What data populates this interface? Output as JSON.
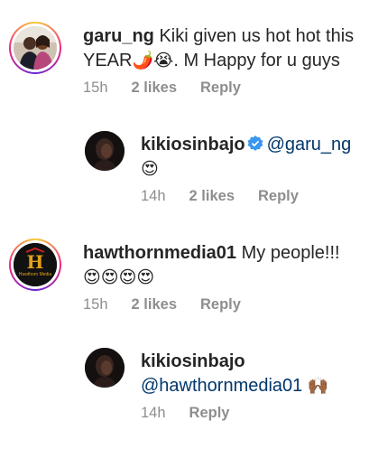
{
  "comments": [
    {
      "username": "garu_ng",
      "text": "Kiki given us hot hot this YEAR",
      "emoji_after_text": "🌶️😭",
      "text_tail": ". M  Happy for u guys",
      "time": "15h",
      "likes": "2 likes",
      "reply": "Reply"
    },
    {
      "username": "kikiosinbajo",
      "mention": "@garu_ng",
      "emoji_line": "😍",
      "time": "14h",
      "likes": "2 likes",
      "reply": "Reply"
    },
    {
      "username": "hawthornmedia01",
      "text": "My people!!!",
      "emoji_line": "😍😍😍😍",
      "time": "15h",
      "likes": "2 likes",
      "reply": "Reply",
      "avatar_logo_letter": "H",
      "avatar_logo_text": "Hawthorn Media"
    },
    {
      "username": "kikiosinbajo",
      "mention": "@hawthornmedia01",
      "emoji_after_text": "🙌🏾",
      "time": "14h",
      "reply": "Reply"
    }
  ],
  "colors": {
    "username": "#262626",
    "meta": "#8e8e8e",
    "mention": "#00376b",
    "verified": "#3897f0"
  }
}
